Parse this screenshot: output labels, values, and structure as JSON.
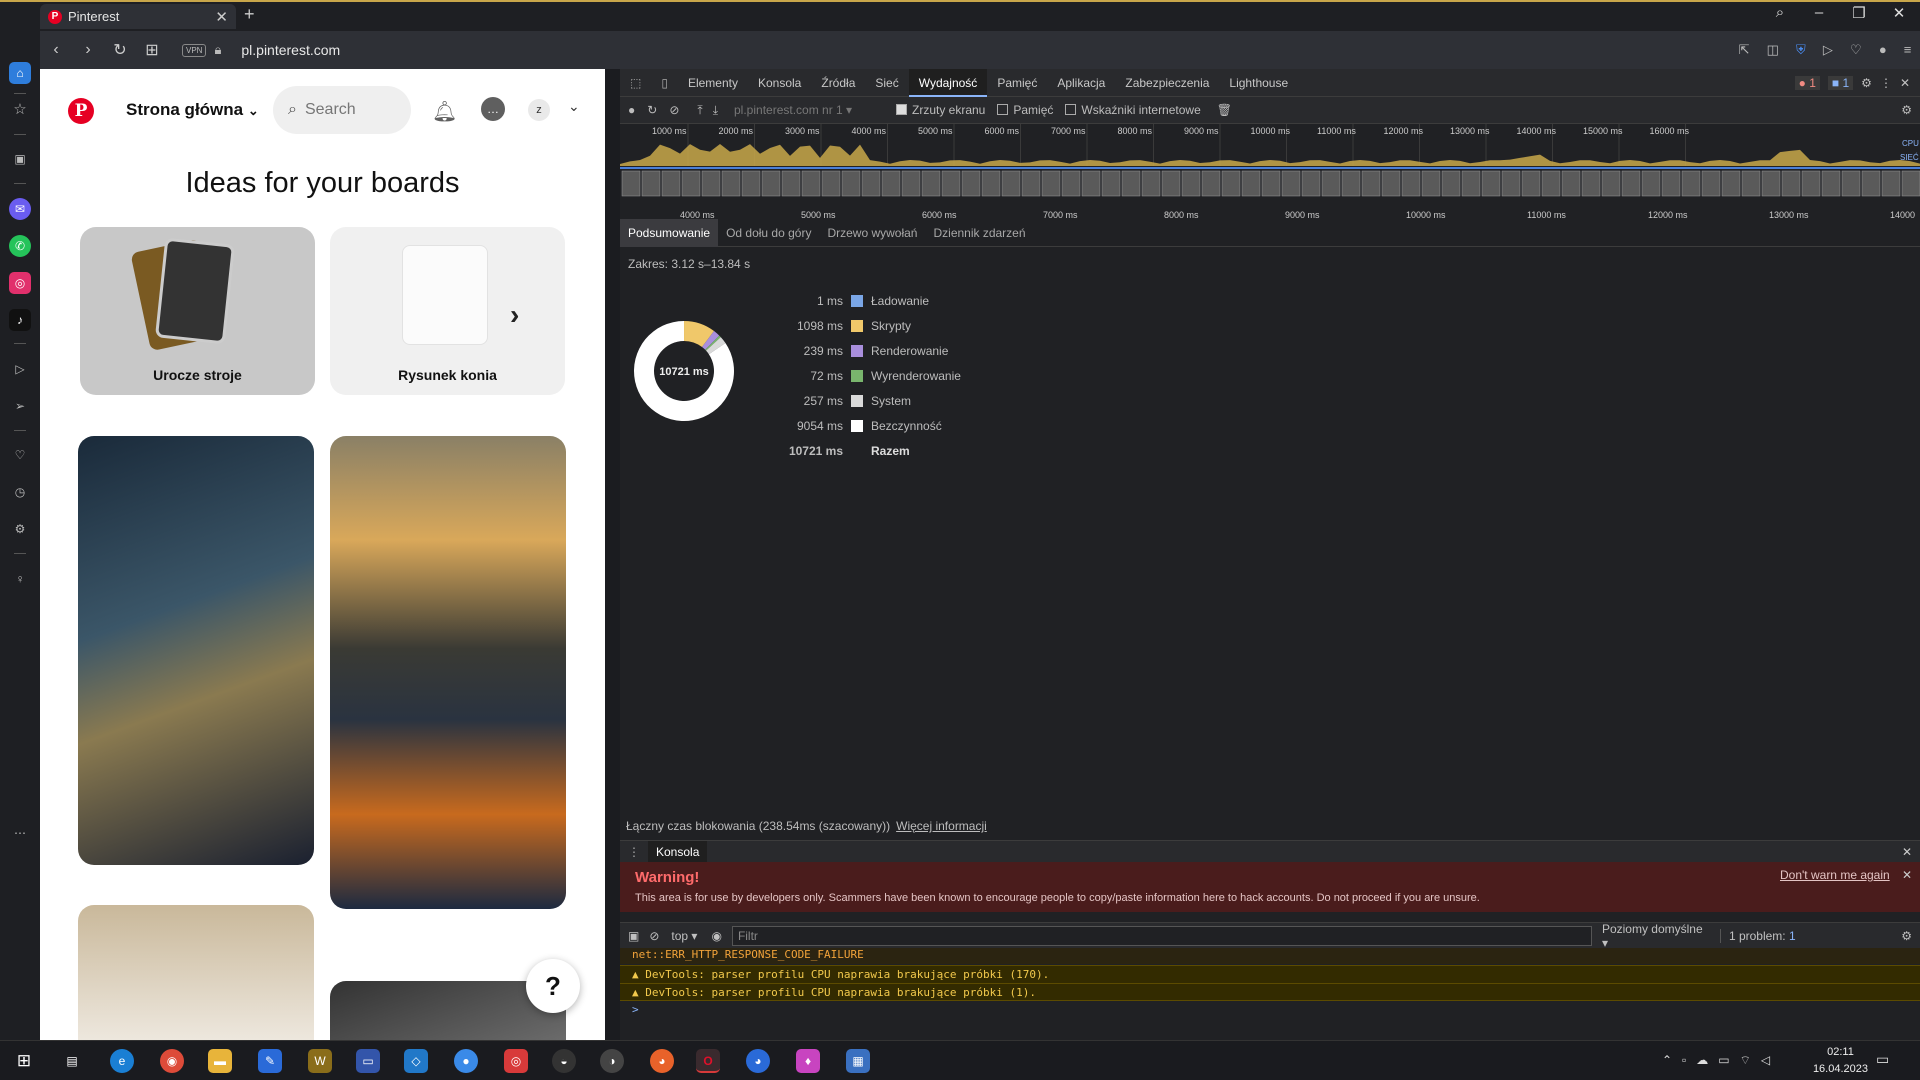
{
  "browser": {
    "tab_title": "Pinterest",
    "tab_close": "✕",
    "new_tab": "+",
    "url": "pl.pinterest.com",
    "vpn": "VPN"
  },
  "pinterest": {
    "home_label": "Strona główna",
    "search_placeholder": "Search",
    "avatar_letter": "z",
    "ideas_heading": "Ideas for your boards",
    "boards": [
      {
        "caption": "Urocze stroje"
      },
      {
        "caption": "Rysunek konia"
      }
    ],
    "help": "?"
  },
  "devtools": {
    "tabs": [
      "Elementy",
      "Konsola",
      "Źródła",
      "Sieć",
      "Wydajność",
      "Pamięć",
      "Aplikacja",
      "Zabezpieczenia",
      "Lighthouse"
    ],
    "active_tab": "Wydajność",
    "errors_badge": "1",
    "messages_badge": "1",
    "recording_select": "pl.pinterest.com nr 1",
    "checkboxes": [
      {
        "label": "Zrzuty ekranu",
        "checked": true
      },
      {
        "label": "Pamięć",
        "checked": false
      },
      {
        "label": "Wskaźniki internetowe",
        "checked": false
      }
    ],
    "ruler_top": [
      "1000 ms",
      "2000 ms",
      "3000 ms",
      "4000 ms",
      "5000 ms",
      "6000 ms",
      "7000 ms",
      "8000 ms",
      "9000 ms",
      "10000 ms",
      "11000 ms",
      "12000 ms",
      "13000 ms",
      "14000 ms",
      "15000 ms",
      "16000 ms"
    ],
    "ruler_bottom": [
      "4000 ms",
      "5000 ms",
      "6000 ms",
      "7000 ms",
      "8000 ms",
      "9000 ms",
      "10000 ms",
      "11000 ms",
      "12000 ms",
      "13000 ms",
      "14000"
    ],
    "cpu_label": "CPU",
    "net_label": "SIEĆ",
    "subtabs": [
      "Podsumowanie",
      "Od dołu do góry",
      "Drzewo wywołań",
      "Dziennik zdarzeń"
    ],
    "range": "Zakres: 3.12 s–13.84 s",
    "summary": [
      {
        "value": "1 ms",
        "label": "Ładowanie",
        "color": "#7aa6e6",
        "ms": 1
      },
      {
        "value": "1098 ms",
        "label": "Skrypty",
        "color": "#f0c86a",
        "ms": 1098
      },
      {
        "value": "239 ms",
        "label": "Renderowanie",
        "color": "#a98fdd",
        "ms": 239
      },
      {
        "value": "72 ms",
        "label": "Wyrenderowanie",
        "color": "#79b56d",
        "ms": 72
      },
      {
        "value": "257 ms",
        "label": "System",
        "color": "#d9d9d9",
        "ms": 257
      },
      {
        "value": "9054 ms",
        "label": "Bezczynność",
        "color": "#ffffff",
        "ms": 9054
      }
    ],
    "total_value": "10721 ms",
    "total_label": "Razem",
    "donut_center": "10721 ms",
    "blocking": "Łączny czas blokowania (238.54ms (szacowany))",
    "more_info": "Więcej informacji",
    "drawer_tab": "Konsola",
    "warning_title": "Warning!",
    "warning_text": "This area is for use by developers only. Scammers have been known to encourage people to copy/paste information here to hack accounts. Do not proceed if you are unsure.",
    "dont_warn": "Don't warn me again",
    "context": "top",
    "filter_placeholder": "Filtr",
    "levels": "Poziomy domyślne",
    "issues": "1 problem:",
    "issues_count": "1",
    "console_lines": [
      "net::ERR_HTTP_RESPONSE_CODE_FAILURE",
      "DevTools: parser profilu CPU naprawia brakujące próbki (170).",
      "DevTools: parser profilu CPU naprawia brakujące próbki (1)."
    ],
    "prompt": ">"
  },
  "taskbar": {
    "time": "02:11",
    "date": "16.04.2023"
  }
}
